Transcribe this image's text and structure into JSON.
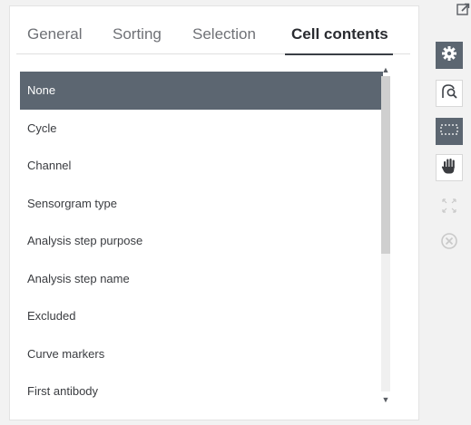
{
  "tabs": [
    {
      "label": "General"
    },
    {
      "label": "Sorting"
    },
    {
      "label": "Selection"
    },
    {
      "label": "Cell contents"
    }
  ],
  "active_tab": "Cell contents",
  "list": {
    "items": [
      {
        "label": "None"
      },
      {
        "label": "Cycle"
      },
      {
        "label": "Channel"
      },
      {
        "label": "Sensorgram type"
      },
      {
        "label": "Analysis step purpose"
      },
      {
        "label": "Analysis step name"
      },
      {
        "label": "Excluded"
      },
      {
        "label": "Curve markers"
      },
      {
        "label": "First antibody"
      }
    ],
    "selected_item": "None"
  },
  "toolbar": {
    "icons": [
      "edit-icon",
      "gear-icon",
      "zoom-select-icon",
      "marquee-select-icon",
      "pan-hand-icon",
      "expand-icon",
      "clear-icon"
    ]
  },
  "colors": {
    "selected_bg": "#5c6671",
    "toolbar_active": "#5c6671",
    "disabled_icon": "#c9c9c9"
  }
}
